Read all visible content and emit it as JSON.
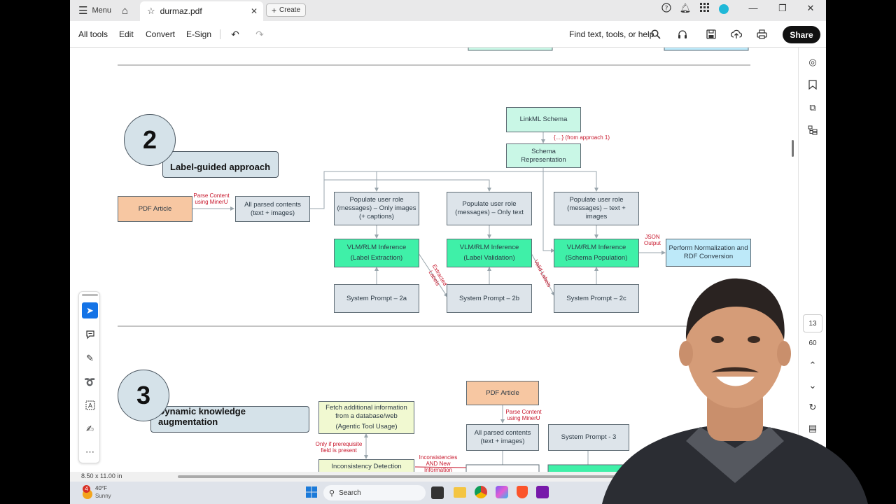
{
  "titlebar": {
    "menu_label": "Menu",
    "tab_title": "durmaz.pdf",
    "create_label": "Create"
  },
  "toolbar": {
    "all_tools": "All tools",
    "edit": "Edit",
    "convert": "Convert",
    "esign": "E-Sign",
    "search_placeholder": "Find text, tools, or help",
    "share": "Share"
  },
  "right_rail": {
    "page_current": "13",
    "page_total": "60"
  },
  "status": {
    "page_size": "8.50 x 11.00 in"
  },
  "taskbar": {
    "weather_badge": "4",
    "temp": "40°F",
    "condition": "Sunny",
    "search_label": "Search"
  },
  "diagram": {
    "approach2": {
      "number": "2",
      "title": "Label-guided approach",
      "linkml": "LinkML Schema",
      "from_approach1": "{....} (from approach 1)",
      "schema_rep": "Schema Representation",
      "pdf_article": "PDF Article",
      "parse_content": "Parse Content using MinerU",
      "all_parsed": "All parsed contents (text + images)",
      "populate_images": "Populate user role (messages) – Only images (+ captions)",
      "populate_text": "Populate user role (messages) – Only text",
      "populate_both": "Populate user role (messages) – text + images",
      "inf_extraction_1": "VLM/RLM Inference",
      "inf_extraction_2": "(Label Extraction)",
      "inf_validation_1": "VLM/RLM Inference",
      "inf_validation_2": "(Label Validation)",
      "inf_population_1": "VLM/RLM Inference",
      "inf_population_2": "(Schema Population)",
      "json_output": "JSON Output",
      "normalize": "Perform Normalization and RDF Conversion",
      "extracted_labels": "Extracted Labels",
      "valid_labels": "Valid Labels",
      "sys_2a": "System Prompt – 2a",
      "sys_2b": "System Prompt – 2b",
      "sys_2c": "System Prompt – 2c"
    },
    "approach3": {
      "number": "3",
      "title": "Dynamic knowledge augmentation",
      "fetch_1": "Fetch additional information from a database/web",
      "fetch_2": "(Agentic Tool Usage)",
      "only_if": "Only if prerequisite field is present",
      "inconsistency": "Inconsistency Detection",
      "inconsistencies_new": "Inconsistencies AND New Information",
      "pdf_article": "PDF Article",
      "parse_content": "Parse Content using MinerU",
      "all_parsed": "All parsed contents (text + images)",
      "sys_3": "System Prompt - 3"
    }
  }
}
